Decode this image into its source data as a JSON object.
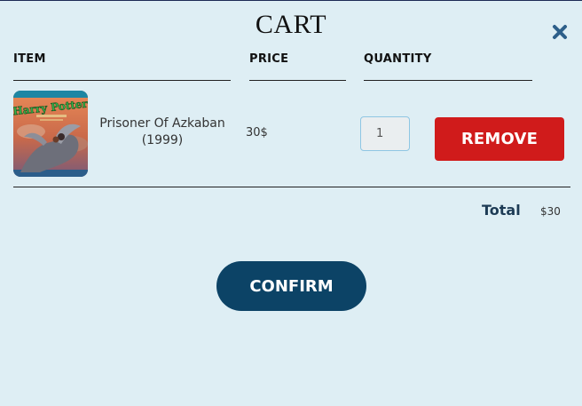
{
  "cart": {
    "title": "CART",
    "close_icon": "close-icon",
    "columns": {
      "item": "ITEM",
      "price": "PRICE",
      "quantity": "QUANTITY"
    },
    "items": [
      {
        "cover_icon": "book-cover-image",
        "cover_text": "Harry Potter",
        "name_line1": "Prisoner Of Azkaban",
        "name_line2": "(1999)",
        "price": "30$",
        "quantity": "1",
        "remove_label": "REMOVE"
      }
    ],
    "total_label": "Total",
    "total_value": "$30",
    "confirm_label": "CONFIRM"
  },
  "colors": {
    "background": "#deeef4",
    "remove_button": "#d01b1b",
    "confirm_button": "#0c4366",
    "total_label": "#1d3b55",
    "close_icon": "#2d5f8a"
  }
}
